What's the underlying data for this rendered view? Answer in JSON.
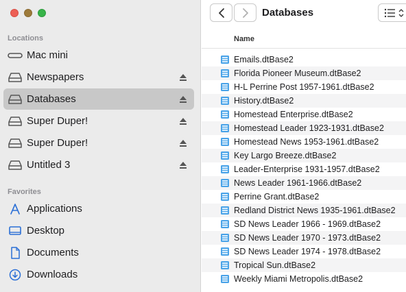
{
  "window": {
    "title": "Databases"
  },
  "sidebar": {
    "locations_title": "Locations",
    "favorites_title": "Favorites",
    "locations": [
      {
        "label": "Mac mini",
        "icon": "computer-icon",
        "eject": false,
        "selected": false
      },
      {
        "label": "Newspapers",
        "icon": "drive-icon",
        "eject": true,
        "selected": false
      },
      {
        "label": "Databases",
        "icon": "drive-icon",
        "eject": true,
        "selected": true
      },
      {
        "label": "Super Duper!",
        "icon": "drive-icon",
        "eject": true,
        "selected": false
      },
      {
        "label": "Super Duper!",
        "icon": "drive-icon",
        "eject": true,
        "selected": false
      },
      {
        "label": "Untitled 3",
        "icon": "drive-icon",
        "eject": true,
        "selected": false
      }
    ],
    "favorites": [
      {
        "label": "Applications",
        "icon": "applications-icon"
      },
      {
        "label": "Desktop",
        "icon": "desktop-icon"
      },
      {
        "label": "Documents",
        "icon": "document-icon"
      },
      {
        "label": "Downloads",
        "icon": "downloads-icon"
      }
    ]
  },
  "list": {
    "column_name": "Name",
    "files": [
      "Emails.dtBase2",
      "Florida Pioneer Museum.dtBase2",
      "H-L Perrine Post 1957-1961.dtBase2",
      "History.dtBase2",
      "Homestead Enterprise.dtBase2",
      "Homestead Leader 1923-1931.dtBase2",
      "Homestead News 1953-1961.dtBase2",
      "Key Largo Breeze.dtBase2",
      "Leader-Enterprise 1931-1957.dtBase2",
      "News Leader 1961-1966.dtBase2",
      "Perrine Grant.dtBase2",
      "Redland District News 1935-1961.dtBase2",
      "SD News Leader 1966 - 1969.dtBase2",
      "SD News Leader 1970 - 1973.dtBase2",
      "SD News Leader 1974 - 1978.dtBase2",
      "Tropical Sun.dtBase2",
      "Weekly Miami Metropolis.dtBase2"
    ]
  },
  "colors": {
    "selection": "#c8c8c8",
    "accent_blue": "#2b6fd6",
    "sidebar_bg": "#ebebeb"
  }
}
